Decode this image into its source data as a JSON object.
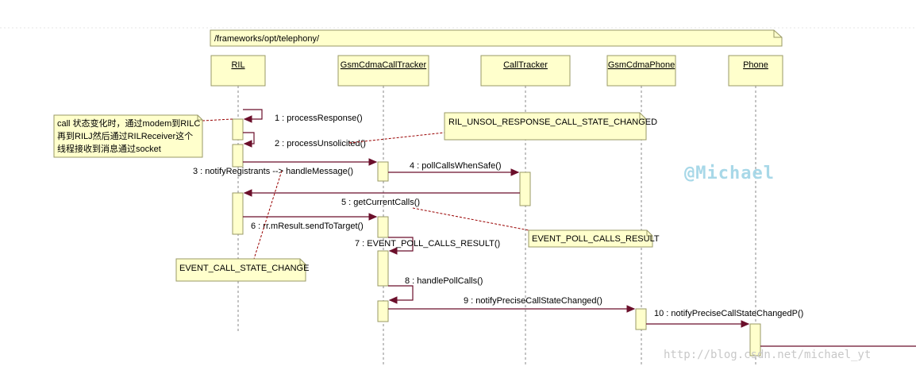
{
  "package": "/frameworks/opt/telephony/",
  "lifelines": [
    {
      "name": "RIL"
    },
    {
      "name": "GsmCdmaCallTracker"
    },
    {
      "name": "CallTracker"
    },
    {
      "name": "GsmCdmaPhone"
    },
    {
      "name": "Phone"
    }
  ],
  "messages": [
    "1 : processResponse()",
    "2 : processUnsolicited()",
    "3 : notifyRegistrants --> handleMessage()",
    "4 : pollCallsWhenSafe()",
    "5 : getCurrentCalls()",
    "6 : rr.mResult.sendToTarget()",
    "7 : EVENT_POLL_CALLS_RESULT()",
    "8 : handlePollCalls()",
    "9 : notifyPreciseCallStateChanged()",
    "10 : notifyPreciseCallStateChangedP()"
  ],
  "notes": {
    "call_note": [
      "call 状态变化时，通过modem到RILC",
      "再到RILJ然后通过RILReceiver这个",
      "线程接收到消息通过socket"
    ],
    "unsol": "RIL_UNSOL_RESPONSE_CALL_STATE_CHANGED",
    "poll_result": "EVENT_POLL_CALLS_RESULT",
    "call_state_change": "EVENT_CALL_STATE_CHANGE"
  },
  "watermarks": {
    "author": "@Michael",
    "url": "http://blog.csdn.net/michael_yt"
  },
  "colors": {
    "box_fill": "#ffffcc",
    "box_stroke": "#999966",
    "line": "#6b0f2b",
    "note_link": "#990000"
  }
}
